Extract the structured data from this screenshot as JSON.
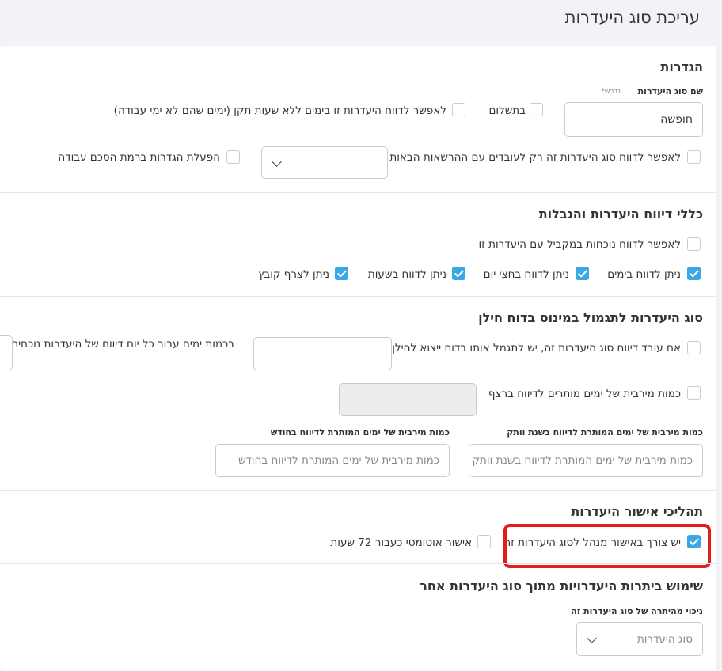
{
  "page_title": "עריכת סוג היעדרות",
  "settings": {
    "title": "הגדרות",
    "name_label": "שם סוג היעדרות",
    "required_mark": "נדרש*",
    "name_value": "חופשה",
    "paid_label": "בתשלום",
    "no_standard_hours_label": "לאפשר לדווח היעדרות זו בימים ללא שעות תקן (ימים שהם לא ימי עבודה)",
    "permissions_only_label": "לאפשר לדווח סוג היעדרות זה רק לעובדים עם ההרשאות הבאות",
    "agreement_settings_label": "הפעלת הגדרות ברמת הסכם עבודה"
  },
  "rules": {
    "title": "כללי דיווח היעדרות והגבלות",
    "parallel_presence_label": "לאפשר לדווח נוכחות במקביל עם היעדרות זו",
    "by_days_label": "ניתן לדווח בימים",
    "half_day_label": "ניתן לדווח בחצי יום",
    "by_hours_label": "ניתן לדווח בשעות",
    "attach_file_label": "ניתן לצרף קובץ"
  },
  "reward": {
    "title": "סוג היעדרות לתגמול במינוס בדוח חילן",
    "reward_label": "אם עובד דיווח סוג היעדרות זה, יש לתגמל אותו בדוח ייצוא לחילן",
    "days_per_day_label": "בכמות ימים עבור כל יום דיווח של היעדרות נוכחית",
    "max_consecutive_label": "כמות מירבית של ימים מותרים לדיווח ברצף",
    "max_seniority_label": "כמות מירבית של ימים המותרת לדיווח בשנת וותק",
    "max_seniority_placeholder": "כמות מירבית של ימים המותרת לדיווח בשנת וותק",
    "max_month_label": "כמות מירבית של ימים המותרת לדיווח בחודש",
    "max_month_placeholder": "כמות מירבית של ימים המותרת לדיווח בחודש"
  },
  "approval": {
    "title": "תהליכי אישור היעדרות",
    "manager_approval_label": "יש צורך באישור מנהל לסוג היעדרות זה",
    "auto_approval_label": "אישור אוטומטי כעבור 72 שעות"
  },
  "balance": {
    "title": "שימוש ביתרות היעדרויות מתוך סוג היעדרות אחר",
    "deduct_label": "ניכוי מהיתרה של סוג היעדרות זה",
    "select_placeholder": "סוג היעדרות"
  },
  "checkbox_states": {
    "paid": false,
    "no_standard_hours": false,
    "permissions_only": false,
    "agreement_settings": false,
    "parallel_presence": false,
    "by_days": true,
    "half_day": true,
    "by_hours": true,
    "attach_file": true,
    "reward": false,
    "max_consecutive": false,
    "manager_approval": true,
    "auto_approval": false
  },
  "colors": {
    "accent": "#3ba8e6",
    "highlight": "#e21d1d"
  }
}
